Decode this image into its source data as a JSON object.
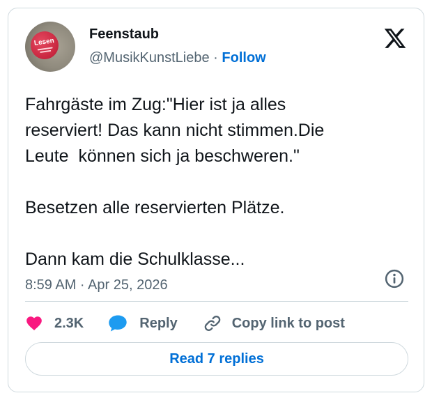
{
  "author": {
    "display_name": "Feenstaub",
    "handle": "@MusikKunstLiebe",
    "separator": "·",
    "follow_label": "Follow",
    "avatar_badge_text": "Lesen"
  },
  "tweet": {
    "text": "Fahrgäste im Zug:\"Hier ist ja alles\nreserviert! Das kann nicht stimmen.Die\nLeute  können sich ja beschweren.\"\n\nBesetzen alle reservierten Plätze.\n\nDann kam die Schulklasse...",
    "timestamp": "8:59 AM · Apr 25, 2026"
  },
  "actions": {
    "like_count": "2.3K",
    "reply_label": "Reply",
    "copy_link_label": "Copy link to post"
  },
  "read_replies_label": "Read 7 replies",
  "icons": {
    "brand": "x-logo-icon",
    "info": "info-icon",
    "like": "heart-icon",
    "reply": "speech-bubble-icon",
    "copy": "link-icon"
  },
  "colors": {
    "text": "#0f1419",
    "muted": "#536471",
    "link": "#006fd6",
    "like": "#f91880",
    "reply": "#1d9bf0",
    "border": "#cfd9de"
  }
}
